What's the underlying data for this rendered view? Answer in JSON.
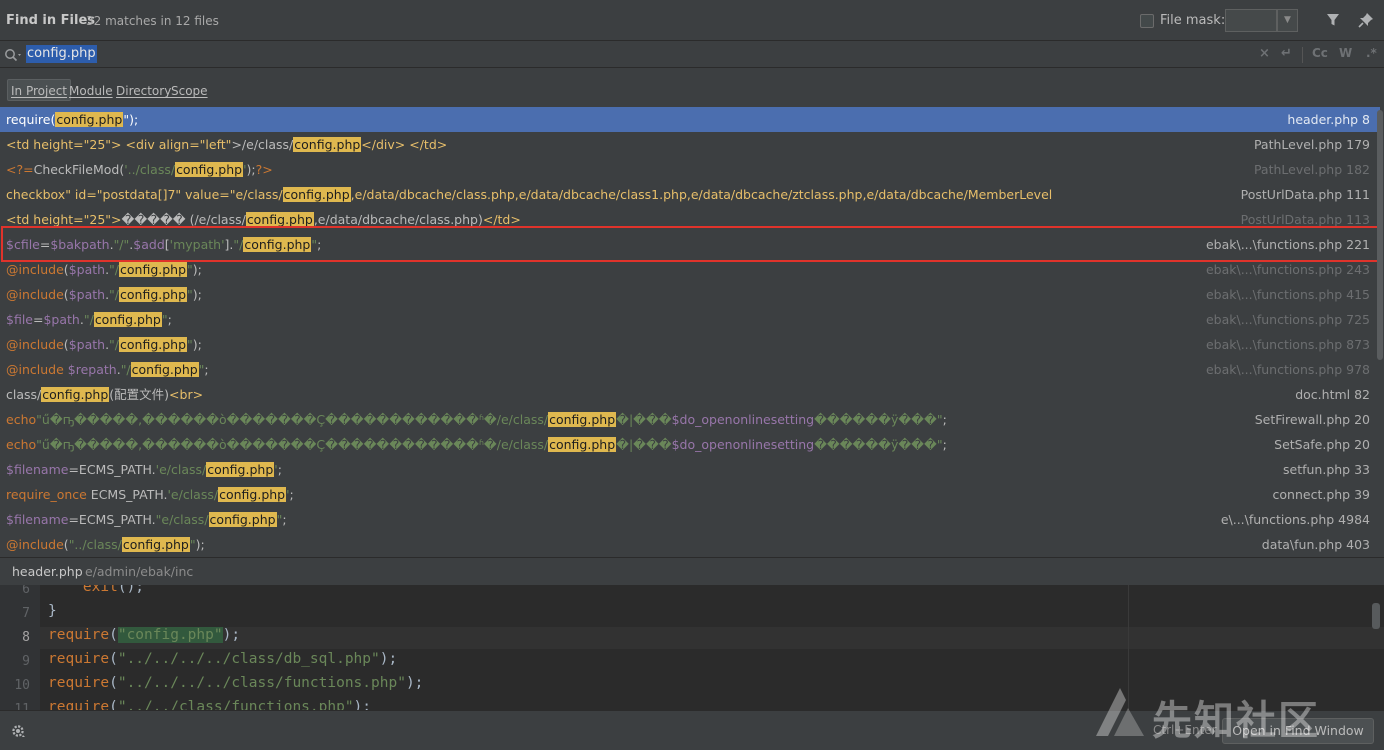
{
  "header": {
    "title": "Find in Files",
    "subtitle": "32 matches in 12 files",
    "file_mask_label": "File mask:",
    "file_mask_value": ""
  },
  "search": {
    "query": "config.php"
  },
  "scopes": [
    {
      "label": "In Project",
      "active": true
    },
    {
      "label": "Module",
      "active": false
    },
    {
      "label": "Directory",
      "active": false
    },
    {
      "label": "Scope",
      "active": false
    }
  ],
  "results": [
    {
      "segments": [
        [
          "pl",
          "require("
        ],
        [
          "hl",
          "config.php"
        ],
        [
          "pl",
          "\");"
        ]
      ],
      "file": "header.php 8",
      "selected": true,
      "dim": false
    },
    {
      "segments": [
        [
          "tag",
          "<td "
        ],
        [
          "tag",
          "height=\"25\""
        ],
        [
          "tag",
          "> "
        ],
        [
          "tag",
          "<div "
        ],
        [
          "tag",
          "align=\"left\""
        ],
        [
          "pl",
          ">/e/class/"
        ],
        [
          "hl",
          "config.php"
        ],
        [
          "tag",
          "</div>"
        ],
        [
          "pl",
          " "
        ],
        [
          "tag",
          "</td>"
        ]
      ],
      "file": "PathLevel.php 179",
      "selected": false,
      "dim": false
    },
    {
      "segments": [
        [
          "kw",
          "<?="
        ],
        [
          "pl",
          "CheckFileMod("
        ],
        [
          "str",
          "'../class/"
        ],
        [
          "hl",
          "config.php"
        ],
        [
          "str",
          "'"
        ],
        [
          "pl",
          ");"
        ],
        [
          "kw",
          "?>"
        ]
      ],
      "file": "PathLevel.php 182",
      "selected": false,
      "dim": true
    },
    {
      "segments": [
        [
          "tag",
          "checkbox\" id=\"postdata[]7\" value=\"e/class/"
        ],
        [
          "hl",
          "config.php"
        ],
        [
          "tag",
          ",e/data/dbcache/class.php,e/data/dbcache/class1.php,e/data/dbcache/ztclass.php,e/data/dbcache/MemberLevel"
        ]
      ],
      "file": "PostUrlData.php 111",
      "selected": false,
      "dim": false
    },
    {
      "segments": [
        [
          "tag",
          "<td "
        ],
        [
          "tag",
          "height=\"25\""
        ],
        [
          "tag",
          ">"
        ],
        [
          "pl",
          "����� (/e/class/"
        ],
        [
          "hl",
          "config.php"
        ],
        [
          "pl",
          ",e/data/dbcache/class.php)"
        ],
        [
          "tag",
          "</td>"
        ]
      ],
      "file": "PostUrlData.php 113",
      "selected": false,
      "dim": true
    },
    {
      "segments": [
        [
          "vr",
          "$cfile"
        ],
        [
          "pl",
          "="
        ],
        [
          "vr",
          "$bakpath"
        ],
        [
          "pl",
          "."
        ],
        [
          "str",
          "\"/\""
        ],
        [
          "pl",
          "."
        ],
        [
          "vr",
          "$add"
        ],
        [
          "pl",
          "["
        ],
        [
          "str",
          "'mypath'"
        ],
        [
          "pl",
          "]."
        ],
        [
          "str",
          "\"/"
        ],
        [
          "hl",
          "config.php"
        ],
        [
          "str",
          "\""
        ],
        [
          "pl",
          ";"
        ]
      ],
      "file": "ebak\\...\\functions.php 221",
      "selected": false,
      "dim": false
    },
    {
      "segments": [
        [
          "kw",
          "@include"
        ],
        [
          "pl",
          "("
        ],
        [
          "vr",
          "$path"
        ],
        [
          "pl",
          "."
        ],
        [
          "str",
          "\"/"
        ],
        [
          "hl",
          "config.php"
        ],
        [
          "str",
          "\""
        ],
        [
          "pl",
          ");"
        ]
      ],
      "file": "ebak\\...\\functions.php 243",
      "selected": false,
      "dim": true
    },
    {
      "segments": [
        [
          "kw",
          "@include"
        ],
        [
          "pl",
          "("
        ],
        [
          "vr",
          "$path"
        ],
        [
          "pl",
          "."
        ],
        [
          "str",
          "\"/"
        ],
        [
          "hl",
          "config.php"
        ],
        [
          "str",
          "\""
        ],
        [
          "pl",
          ");"
        ]
      ],
      "file": "ebak\\...\\functions.php 415",
      "selected": false,
      "dim": true
    },
    {
      "segments": [
        [
          "vr",
          "$file"
        ],
        [
          "pl",
          "="
        ],
        [
          "vr",
          "$path"
        ],
        [
          "pl",
          "."
        ],
        [
          "str",
          "\"/"
        ],
        [
          "hl",
          "config.php"
        ],
        [
          "str",
          "\""
        ],
        [
          "pl",
          ";"
        ]
      ],
      "file": "ebak\\...\\functions.php 725",
      "selected": false,
      "dim": true
    },
    {
      "segments": [
        [
          "kw",
          "@include"
        ],
        [
          "pl",
          "("
        ],
        [
          "vr",
          "$path"
        ],
        [
          "pl",
          "."
        ],
        [
          "str",
          "\"/"
        ],
        [
          "hl",
          "config.php"
        ],
        [
          "str",
          "\""
        ],
        [
          "pl",
          ");"
        ]
      ],
      "file": "ebak\\...\\functions.php 873",
      "selected": false,
      "dim": true
    },
    {
      "segments": [
        [
          "kw",
          "@include "
        ],
        [
          "vr",
          "$repath"
        ],
        [
          "pl",
          "."
        ],
        [
          "str",
          "\"/"
        ],
        [
          "hl",
          "config.php"
        ],
        [
          "str",
          "\""
        ],
        [
          "pl",
          ";"
        ]
      ],
      "file": "ebak\\...\\functions.php 978",
      "selected": false,
      "dim": true
    },
    {
      "segments": [
        [
          "pl",
          "class/"
        ],
        [
          "hl",
          "config.php"
        ],
        [
          "pl",
          "(配置文件)"
        ],
        [
          "tag",
          "<br>"
        ]
      ],
      "file": "doc.html 82",
      "selected": false,
      "dim": false
    },
    {
      "segments": [
        [
          "kw",
          "echo"
        ],
        [
          "str",
          "\"ű�ҧ�����,������ò�������Ç������������ʱ�/e/class/"
        ],
        [
          "hl",
          "config.php"
        ],
        [
          "str",
          "�|���"
        ],
        [
          "vr",
          "$do_openonlinesetting"
        ],
        [
          "str",
          "������ÿ���\""
        ],
        [
          "pl",
          ";"
        ]
      ],
      "file": "SetFirewall.php 20",
      "selected": false,
      "dim": false
    },
    {
      "segments": [
        [
          "kw",
          "echo"
        ],
        [
          "str",
          "\"ű�ҧ�����,������ò�������Ç������������ʱ�/e/class/"
        ],
        [
          "hl",
          "config.php"
        ],
        [
          "str",
          "�|���"
        ],
        [
          "vr",
          "$do_openonlinesetting"
        ],
        [
          "str",
          "������ÿ���\""
        ],
        [
          "pl",
          ";"
        ]
      ],
      "file": "SetSafe.php 20",
      "selected": false,
      "dim": false
    },
    {
      "segments": [
        [
          "vr",
          "$filename"
        ],
        [
          "pl",
          "=ECMS_PATH."
        ],
        [
          "str",
          "'e/class/"
        ],
        [
          "hl",
          "config.php"
        ],
        [
          "str",
          "'"
        ],
        [
          "pl",
          ";"
        ]
      ],
      "file": "setfun.php 33",
      "selected": false,
      "dim": false
    },
    {
      "segments": [
        [
          "kw",
          "require_once "
        ],
        [
          "pl",
          "ECMS_PATH."
        ],
        [
          "str",
          "'e/class/"
        ],
        [
          "hl",
          "config.php"
        ],
        [
          "str",
          "'"
        ],
        [
          "pl",
          ";"
        ]
      ],
      "file": "connect.php 39",
      "selected": false,
      "dim": false
    },
    {
      "segments": [
        [
          "vr",
          "$filename"
        ],
        [
          "pl",
          "=ECMS_PATH."
        ],
        [
          "str",
          "\"e/class/"
        ],
        [
          "hl",
          "config.php"
        ],
        [
          "str",
          "\""
        ],
        [
          "pl",
          ";"
        ]
      ],
      "file": "e\\...\\functions.php 4984",
      "selected": false,
      "dim": false
    },
    {
      "segments": [
        [
          "kw",
          "@include"
        ],
        [
          "pl",
          "("
        ],
        [
          "str",
          "\"../class/"
        ],
        [
          "hl",
          "config.php"
        ],
        [
          "str",
          "\""
        ],
        [
          "pl",
          ");"
        ]
      ],
      "file": "data\\fun.php 403",
      "selected": false,
      "dim": false
    }
  ],
  "preview": {
    "file": "header.php",
    "path": "e/admin/ebak/inc"
  },
  "editor_lines": [
    {
      "num": "6",
      "tokens": [
        [
          "plain",
          "    "
        ],
        [
          "kw",
          "exit"
        ],
        [
          "plain",
          "();"
        ]
      ]
    },
    {
      "num": "7",
      "tokens": [
        [
          "plain",
          "}"
        ]
      ]
    },
    {
      "num": "8",
      "tokens": [
        [
          "kw",
          "require"
        ],
        [
          "plain",
          "("
        ],
        [
          "match",
          "\"config.php\""
        ],
        [
          "plain",
          ");"
        ]
      ],
      "current": true
    },
    {
      "num": "9",
      "tokens": [
        [
          "kw",
          "require"
        ],
        [
          "plain",
          "("
        ],
        [
          "str",
          "\"../../../../class/db_sql.php\""
        ],
        [
          "plain",
          ");"
        ]
      ]
    },
    {
      "num": "10",
      "tokens": [
        [
          "kw",
          "require"
        ],
        [
          "plain",
          "("
        ],
        [
          "str",
          "\"../../../../class/functions.php\""
        ],
        [
          "plain",
          ");"
        ]
      ]
    },
    {
      "num": "11",
      "tokens": [
        [
          "kw",
          "require"
        ],
        [
          "plain",
          "("
        ],
        [
          "str",
          "\"../../class/functions.php\""
        ],
        [
          "plain",
          ");"
        ]
      ]
    }
  ],
  "footer": {
    "shortcut_hint": "Ctrl+Enter",
    "open_button": "Open in Find Window"
  },
  "watermark": "先知社区",
  "colors": {
    "highlight": "#dfb84f",
    "selection": "#4b6eaf",
    "annotation_box": "#e0332b"
  }
}
